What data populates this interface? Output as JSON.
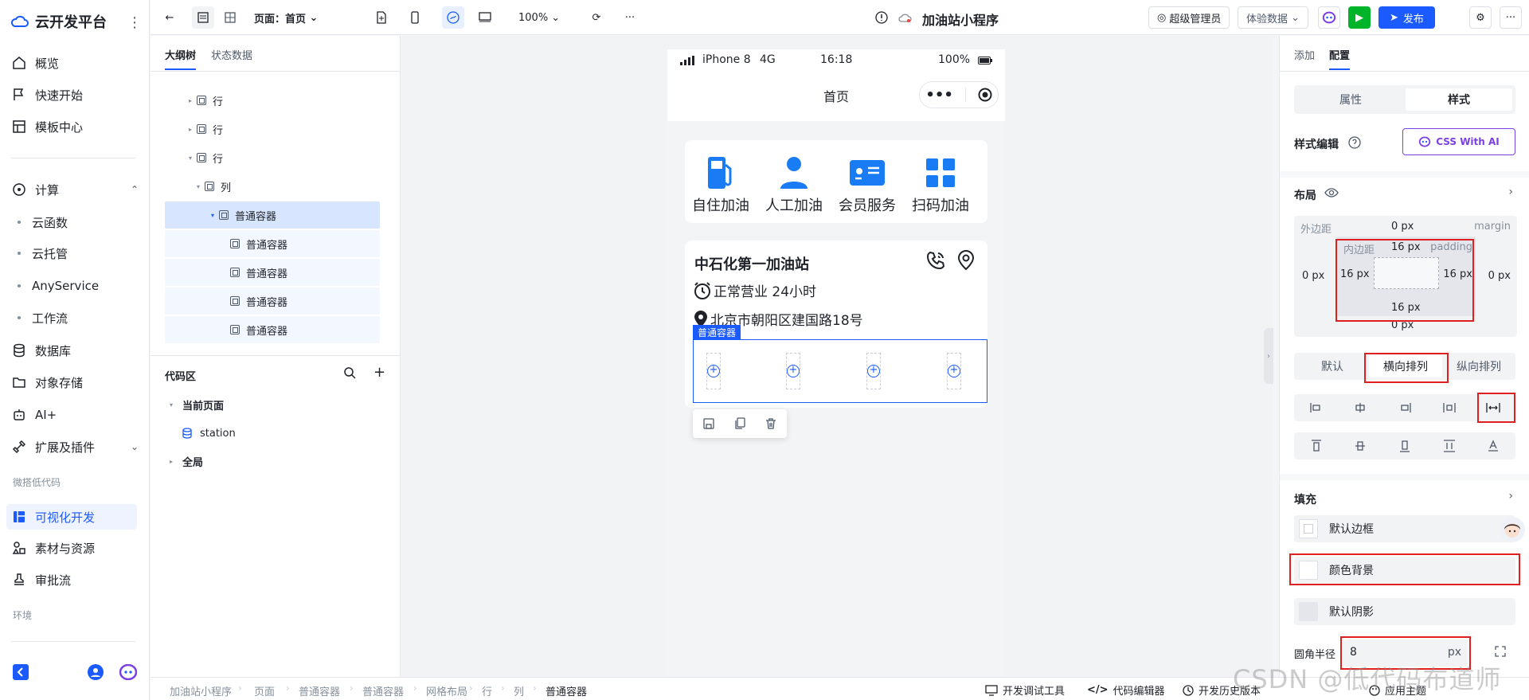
{
  "brand": {
    "name": "云开发平台"
  },
  "sidebar": {
    "items": [
      {
        "label": "概览"
      },
      {
        "label": "快速开始"
      },
      {
        "label": "模板中心"
      },
      {
        "label": "计算"
      },
      {
        "label": "数据库"
      },
      {
        "label": "对象存储"
      },
      {
        "label": "AI+"
      },
      {
        "label": "扩展及插件"
      }
    ],
    "compute_children": [
      {
        "label": "云函数"
      },
      {
        "label": "云托管"
      },
      {
        "label": "AnyService"
      },
      {
        "label": "工作流"
      }
    ],
    "group_lowcode": "微搭低代码",
    "lowcode_items": [
      {
        "label": "可视化开发"
      },
      {
        "label": "素材与资源"
      },
      {
        "label": "审批流"
      }
    ],
    "group_env": "环境"
  },
  "toolbar": {
    "page_label": "页面：首页",
    "zoom": "100%",
    "app_title": "加油站小程序",
    "role": "超级管理员",
    "data_mode": "体验数据",
    "publish": "发布",
    "more": "···"
  },
  "outline": {
    "tabs": [
      "大纲树",
      "状态数据"
    ],
    "tree": [
      {
        "label": "行"
      },
      {
        "label": "行"
      },
      {
        "label": "行"
      },
      {
        "label": "列"
      },
      {
        "label": "普通容器"
      },
      {
        "label": "普通容器"
      },
      {
        "label": "普通容器"
      },
      {
        "label": "普通容器"
      },
      {
        "label": "普通容器"
      }
    ],
    "code_title": "代码区",
    "code_groups": [
      {
        "label": "当前页面"
      },
      {
        "label": "station"
      },
      {
        "label": "全局"
      }
    ]
  },
  "phone": {
    "carrier": "iPhone 8",
    "network": "4G",
    "time": "16:18",
    "battery": "100%",
    "nav_title": "首页",
    "services": [
      {
        "label": "自住加油"
      },
      {
        "label": "人工加油"
      },
      {
        "label": "会员服务"
      },
      {
        "label": "扫码加油"
      }
    ],
    "station_name": "中石化第一加油站",
    "hours": "正常营业 24小时",
    "address": "北京市朝阳区建国路18号",
    "selected_tag": "普通容器"
  },
  "right": {
    "tabs": [
      "添加",
      "配置"
    ],
    "segments": [
      "属性",
      "样式"
    ],
    "style_edit": "样式编辑",
    "css_ai": "CSS With AI",
    "layout_title": "布局",
    "margin_label": "外边距",
    "margin_en": "margin",
    "padding_label": "内边距",
    "padding_en": "padding",
    "margin_top": "0 px",
    "margin_left": "0 px",
    "margin_right": "0 px",
    "margin_bottom": "0 px",
    "padding_top": "16 px",
    "padding_left": "16 px",
    "padding_right": "16 px",
    "padding_bottom": "16 px",
    "direction": [
      "默认",
      "横向排列",
      "纵向排列"
    ],
    "fill_title": "填充",
    "border_default": "默认边框",
    "bg_color": "颜色背景",
    "shadow_default": "默认阴影",
    "radius_label": "圆角半径",
    "radius_value": "8",
    "radius_unit": "px"
  },
  "breadcrumb": [
    "加油站小程序",
    "页面",
    "普通容器",
    "普通容器",
    "网格布局",
    "行",
    "列",
    "普通容器"
  ],
  "bottom_tools": [
    "开发调试工具",
    "代码编辑器",
    "开发历史版本",
    "应用主题"
  ],
  "watermark": "CSDN @低代码布道师",
  "colors": {
    "accent": "#1a5aff",
    "highlight": "#e02020",
    "green": "#00b42a"
  }
}
